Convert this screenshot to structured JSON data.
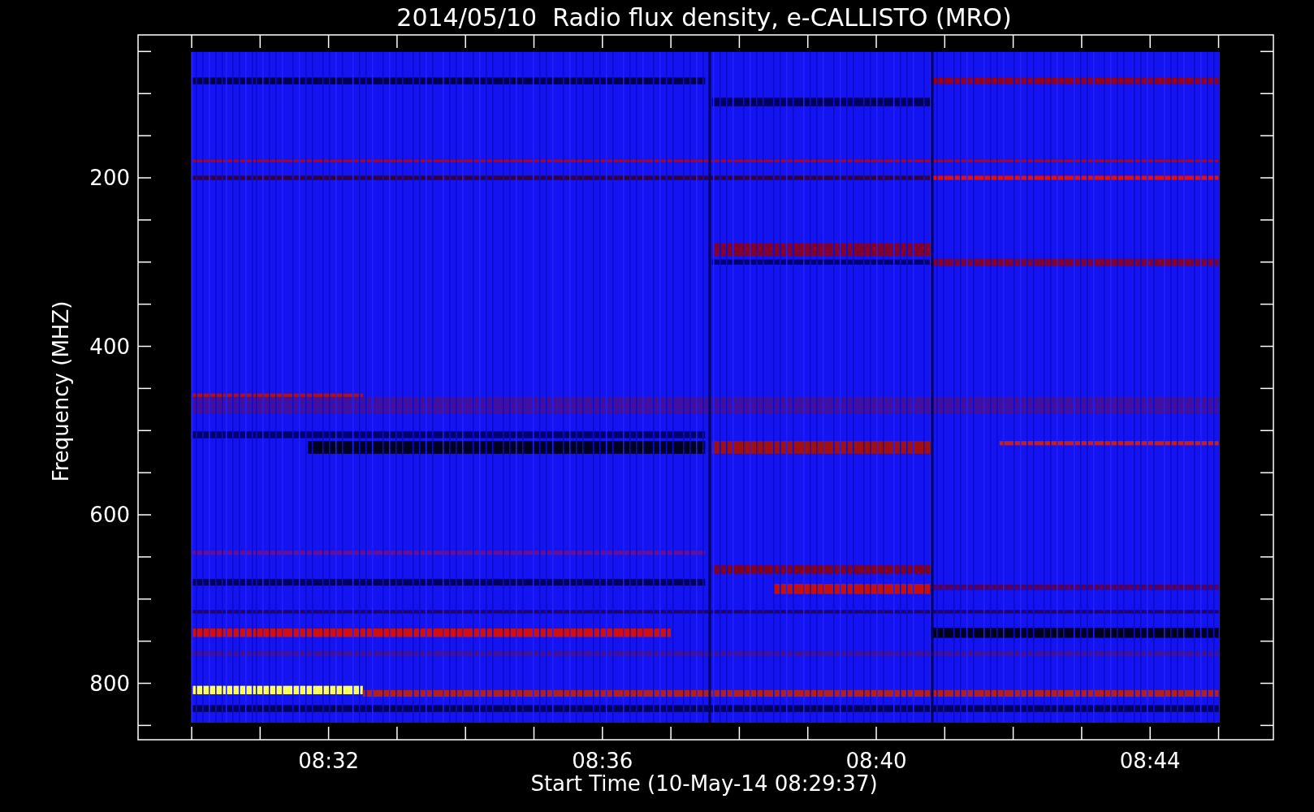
{
  "plot": {
    "title": "2014/05/10  Radio flux density, e-CALLISTO (MRO)",
    "ylabel": "Frequency (MHZ)",
    "xlabel": "Start Time (10-May-14 08:29:37)",
    "yticks": [
      "200",
      "400",
      "600",
      "800"
    ],
    "xticks": [
      "08:32",
      "08:36",
      "08:40",
      "08:44"
    ]
  }
}
